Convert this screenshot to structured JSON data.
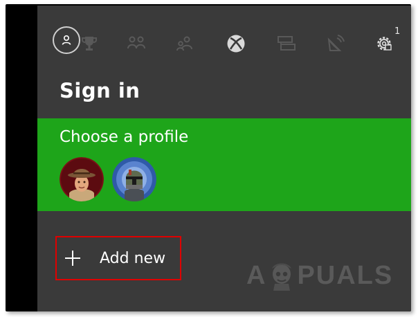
{
  "nav": {
    "icons": [
      "profile-icon",
      "achievements-icon",
      "friends-icon",
      "party-icon",
      "xbox-icon",
      "messages-icon",
      "broadcast-icon",
      "settings-icon"
    ],
    "settings_badge": "1"
  },
  "signin": {
    "title": "Sign in",
    "choose_label": "Choose a profile",
    "profiles": [
      "explorer-avatar",
      "bounty-hunter-avatar"
    ],
    "add_new_label": "Add new"
  },
  "watermark": {
    "prefix": "A",
    "suffix": "PUALS"
  },
  "colors": {
    "panel": "#3a3a3a",
    "green": "#1ea51a",
    "highlight": "#e00000"
  }
}
